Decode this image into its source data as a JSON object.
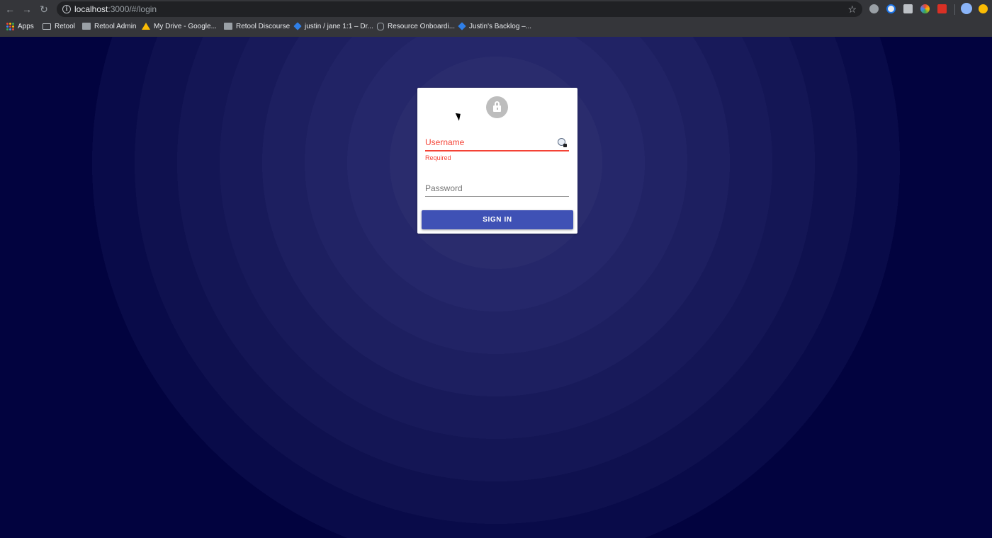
{
  "browser": {
    "url_host": "localhost",
    "url_path": ":3000/#/login",
    "bookmarks": [
      {
        "label": "Apps",
        "icon": "apps-grid-icon"
      },
      {
        "label": "Retool",
        "icon": "folder-icon"
      },
      {
        "label": "Retool Admin",
        "icon": "page-icon"
      },
      {
        "label": "My Drive - Google...",
        "icon": "google-drive-icon"
      },
      {
        "label": "Retool Discourse",
        "icon": "page-icon"
      },
      {
        "label": "justin / jane 1:1 – Dr...",
        "icon": "dropbox-icon"
      },
      {
        "label": "Resource Onboardi...",
        "icon": "link-icon"
      },
      {
        "label": "Justin's Backlog –...",
        "icon": "dropbox-icon"
      }
    ],
    "extensions": [
      "google-drive-extension-icon",
      "password-manager-extension-icon",
      "camera-extension-icon",
      "color-extension-icon",
      "red-extension-icon"
    ]
  },
  "login": {
    "username_label": "Username",
    "username_error": "Required",
    "password_label": "Password",
    "signin_label": "SIGN IN"
  },
  "colors": {
    "page_background": "#02033f",
    "error": "#f44336",
    "primary_button": "#3f51b5",
    "avatar": "#bdbdbd"
  }
}
